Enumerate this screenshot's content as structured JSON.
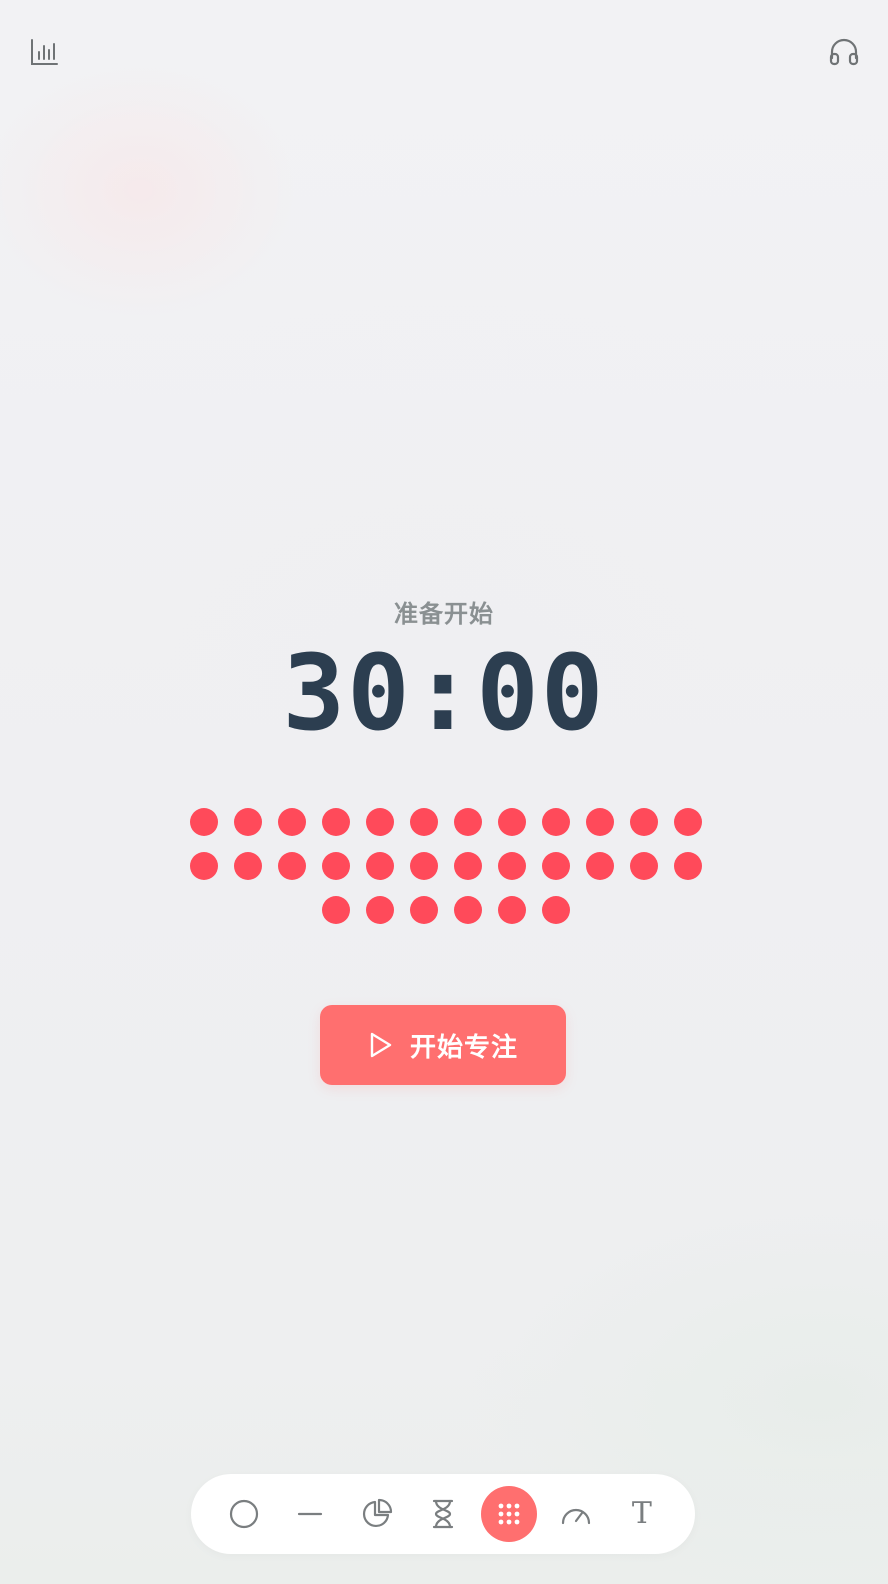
{
  "header": {
    "stats_icon": "bar-chart-icon",
    "audio_icon": "headphones-icon"
  },
  "timer": {
    "status": "准备开始",
    "display": "30:00",
    "dot_count": 30,
    "dot_color": "#ff4a5a"
  },
  "start_button": {
    "label": "开始专注",
    "icon": "play-icon",
    "color": "#ff6f6f"
  },
  "mode_bar": {
    "active_index": 4,
    "modes": [
      {
        "icon": "circle-icon"
      },
      {
        "icon": "line-icon"
      },
      {
        "icon": "pie-chart-icon"
      },
      {
        "icon": "hourglass-icon"
      },
      {
        "icon": "dots-grid-icon"
      },
      {
        "icon": "speedometer-icon"
      },
      {
        "icon": "text-icon",
        "label": "T"
      }
    ]
  },
  "colors": {
    "accent": "#ff6f6f",
    "text_dark": "#2c3e50",
    "text_muted": "#8a9092",
    "icon_gray": "#7a7e80"
  }
}
